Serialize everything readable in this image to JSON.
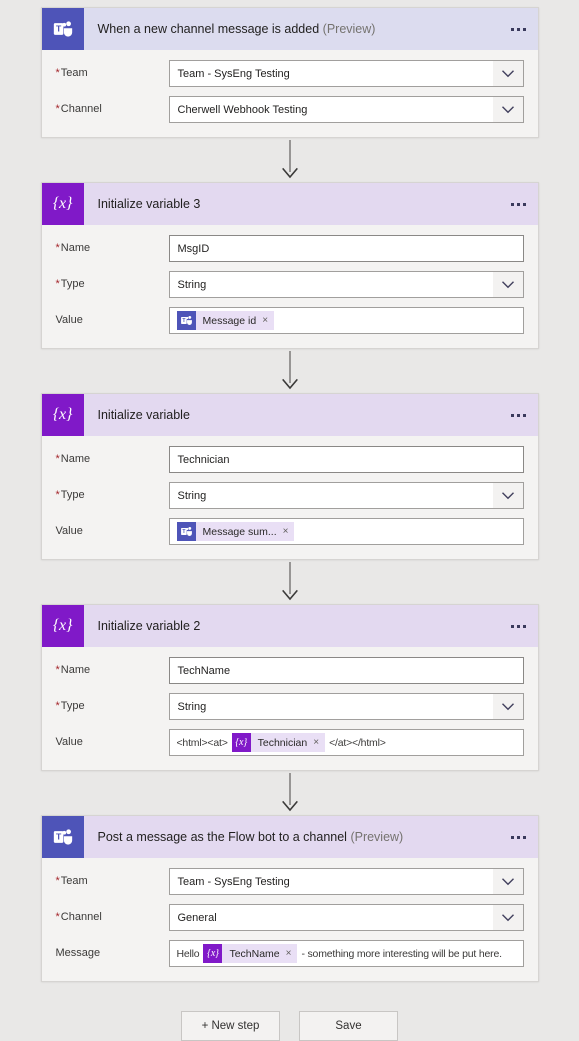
{
  "theme": {
    "page_background": "#e9e8e7",
    "card_background": "#f4f3f2",
    "trigger_header": "#dcdcef",
    "action_header": "#e3d9f0",
    "teams_icon_color": "#4e54b8",
    "variable_icon_color": "#8019c8",
    "required_asterisk_color": "#a4262c",
    "token_chip_background": "#e9dff5"
  },
  "labels": {
    "team": "Team",
    "channel": "Channel",
    "name": "Name",
    "type": "Type",
    "value": "Value",
    "message": "Message",
    "preview_suffix": "(Preview)",
    "required_marker": "*",
    "chip_remove": "×"
  },
  "icons": {
    "teams": "microsoft-teams-icon",
    "variable": "variable-braces-icon",
    "more": "ellipsis-icon",
    "dropdown": "chevron-down-icon",
    "arrow": "arrow-down-icon",
    "variable_glyph": "{x}"
  },
  "steps": [
    {
      "id": "trigger-teams-new-channel-message",
      "kind": "trigger",
      "icon": "microsoft-teams-icon",
      "title": "When a new channel message is added",
      "preview": true,
      "fields": [
        {
          "label": "Team",
          "required": true,
          "control": "dropdown",
          "value": "Team - SysEng Testing"
        },
        {
          "label": "Channel",
          "required": true,
          "control": "dropdown",
          "value": "Cherwell Webhook Testing"
        }
      ]
    },
    {
      "id": "initialize-variable-3",
      "kind": "action",
      "icon": "variable-braces-icon",
      "title": "Initialize variable 3",
      "preview": false,
      "fields": [
        {
          "label": "Name",
          "required": true,
          "control": "text",
          "value": "MsgID"
        },
        {
          "label": "Type",
          "required": true,
          "control": "dropdown",
          "value": "String"
        },
        {
          "label": "Value",
          "required": false,
          "control": "tokens",
          "tokens": [
            {
              "type": "chip",
              "icon": "microsoft-teams-icon",
              "text": "Message id"
            }
          ]
        }
      ]
    },
    {
      "id": "initialize-variable",
      "kind": "action",
      "icon": "variable-braces-icon",
      "title": "Initialize variable",
      "preview": false,
      "fields": [
        {
          "label": "Name",
          "required": true,
          "control": "text",
          "value": "Technician"
        },
        {
          "label": "Type",
          "required": true,
          "control": "dropdown",
          "value": "String"
        },
        {
          "label": "Value",
          "required": false,
          "control": "tokens",
          "tokens": [
            {
              "type": "chip",
              "icon": "microsoft-teams-icon",
              "text": "Message sum..."
            }
          ]
        }
      ]
    },
    {
      "id": "initialize-variable-2",
      "kind": "action",
      "icon": "variable-braces-icon",
      "title": "Initialize variable 2",
      "preview": false,
      "fields": [
        {
          "label": "Name",
          "required": true,
          "control": "text",
          "value": "TechName"
        },
        {
          "label": "Type",
          "required": true,
          "control": "dropdown",
          "value": "String"
        },
        {
          "label": "Value",
          "required": false,
          "control": "tokens",
          "tokens": [
            {
              "type": "text",
              "text": "<html><at>"
            },
            {
              "type": "chip",
              "icon": "variable-braces-icon",
              "text": "Technician"
            },
            {
              "type": "text",
              "text": "</at></html>"
            }
          ]
        }
      ]
    },
    {
      "id": "post-message-flow-bot",
      "kind": "action",
      "icon": "microsoft-teams-icon",
      "title": "Post a message as the Flow bot to a channel",
      "preview": true,
      "fields": [
        {
          "label": "Team",
          "required": true,
          "control": "dropdown",
          "value": "Team - SysEng Testing"
        },
        {
          "label": "Channel",
          "required": true,
          "control": "dropdown",
          "value": "General"
        },
        {
          "label": "Message",
          "required": false,
          "control": "tokens",
          "tokens": [
            {
              "type": "text",
              "text": "Hello"
            },
            {
              "type": "chip",
              "icon": "variable-braces-icon",
              "text": "TechName"
            },
            {
              "type": "text",
              "text": "- something more interesting will be put here."
            }
          ]
        }
      ]
    }
  ],
  "footer": {
    "new_step_label": "+ New step",
    "save_label": "Save"
  }
}
